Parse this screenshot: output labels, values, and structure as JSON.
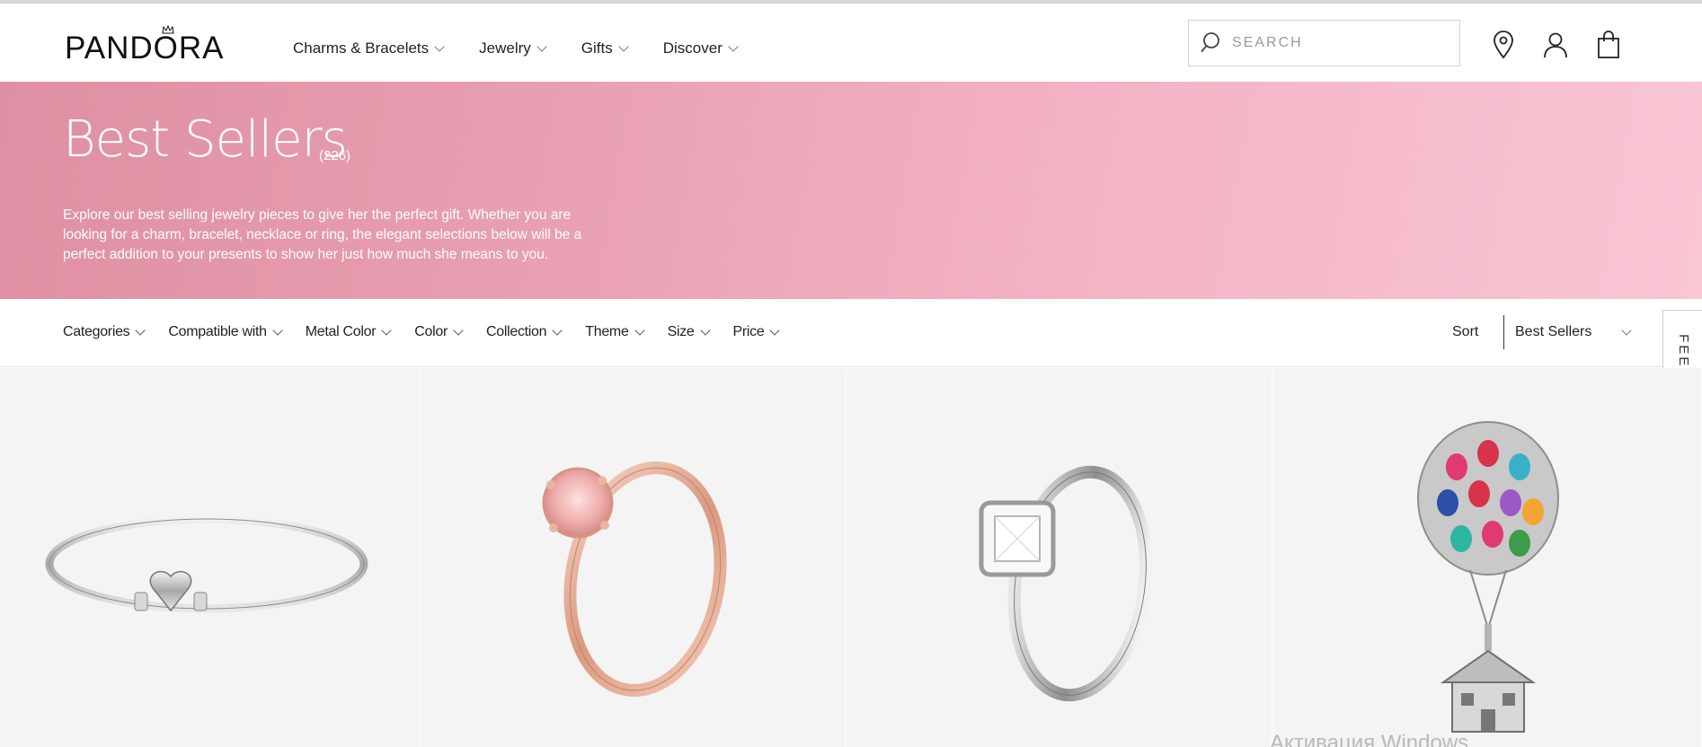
{
  "brand": {
    "name": "PANDORA"
  },
  "nav": {
    "items": [
      {
        "label": "Charms & Bracelets"
      },
      {
        "label": "Jewelry"
      },
      {
        "label": "Gifts"
      },
      {
        "label": "Discover"
      }
    ]
  },
  "search": {
    "placeholder": "SEARCH",
    "value": ""
  },
  "header_icons": [
    "search-icon",
    "location-pin-icon",
    "account-icon",
    "shopping-bag-icon"
  ],
  "banner": {
    "title": "Best Sellers",
    "count": "(226)",
    "description": "Explore our best selling jewelry pieces to give her the perfect gift. Whether you are looking for a charm, bracelet, necklace or ring, the elegant selections below will be a perfect addition to your presents to show her just how much she means to you."
  },
  "filters": [
    {
      "label": "Categories"
    },
    {
      "label": "Compatible with"
    },
    {
      "label": "Metal Color"
    },
    {
      "label": "Color"
    },
    {
      "label": "Collection"
    },
    {
      "label": "Theme"
    },
    {
      "label": "Size"
    },
    {
      "label": "Price"
    }
  ],
  "sort": {
    "label": "Sort",
    "selected": "Best Sellers"
  },
  "feedback": {
    "label": "FEEDBACK"
  },
  "products": [
    {
      "image": "silver-heart-clasp-snake-chain-bracelet"
    },
    {
      "image": "rose-gold-pink-sparkling-crown-ring"
    },
    {
      "image": "silver-square-halo-ring"
    },
    {
      "image": "up-house-balloons-dangle-charm"
    }
  ],
  "system": {
    "watermark": "Активация Windows"
  },
  "colors": {
    "banner_start": "#df8fa3",
    "banner_end": "#f9c6d4",
    "tile_bg": "#f4f4f4"
  }
}
